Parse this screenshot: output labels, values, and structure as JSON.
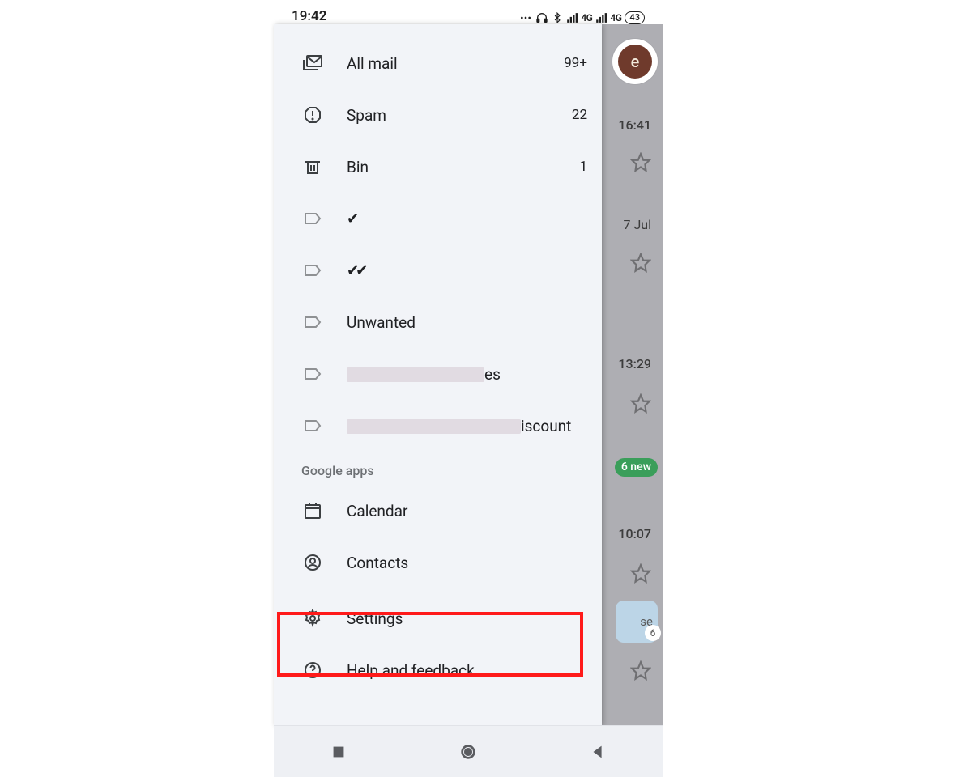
{
  "status": {
    "time": "19:42",
    "net_label": "4G",
    "battery": "43"
  },
  "peek": {
    "avatar_initial": "e",
    "r1_time": "16:41",
    "r2_date": "7 Jul",
    "r3_time": "13:29",
    "badge": "6 new",
    "r4_time": "10:07",
    "chip_text": "se",
    "chip_sub": "6"
  },
  "drawer": {
    "items": [
      {
        "label": "All mail",
        "count": "99+"
      },
      {
        "label": "Spam",
        "count": "22"
      },
      {
        "label": "Bin",
        "count": "1"
      },
      {
        "label": "✔"
      },
      {
        "label": "✔✔"
      },
      {
        "label": "Unwanted"
      },
      {
        "label_suffix": "es"
      },
      {
        "label_suffix": "iscount"
      }
    ],
    "section_google": "Google apps",
    "google_items": [
      {
        "label": "Calendar"
      },
      {
        "label": "Contacts"
      }
    ],
    "bottom_items": [
      {
        "label": "Settings"
      },
      {
        "label": "Help and feedback"
      }
    ]
  }
}
